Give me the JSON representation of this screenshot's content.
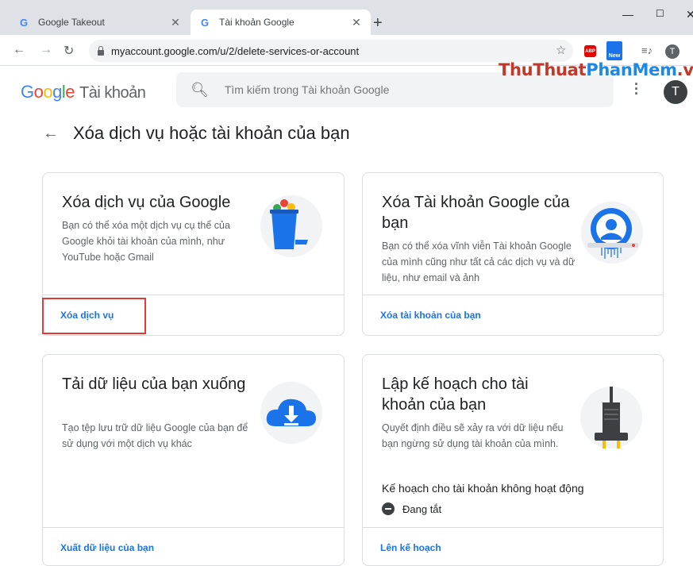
{
  "browser": {
    "tabs": [
      {
        "title": "Google Takeout",
        "icon": "G"
      },
      {
        "title": "Tài khoản Google",
        "icon": "G"
      }
    ],
    "new_tab": "+",
    "window_controls": {
      "minimize": "—",
      "maximize": "☐",
      "close": "✕"
    },
    "nav": {
      "back": "←",
      "forward": "→",
      "reload": "↻"
    },
    "url": "myaccount.google.com/u/2/delete-services-or-account",
    "star": "☆",
    "abp_label": "ABP",
    "new_ext_label": "New",
    "media_icon": "≡♪",
    "profile_initial": "T"
  },
  "watermark": {
    "part1": "ThuThuat",
    "part2": "PhanMem",
    "part3": ".vn"
  },
  "header": {
    "logo_letters": [
      "G",
      "o",
      "o",
      "g",
      "l",
      "e"
    ],
    "logo_colors": [
      "#4285f4",
      "#ea4335",
      "#fbbc05",
      "#4285f4",
      "#34a853",
      "#ea4335"
    ],
    "product": "Tài khoản",
    "search_placeholder": "Tìm kiếm trong Tài khoản Google",
    "avatar_initial": "T"
  },
  "page": {
    "back": "←",
    "title": "Xóa dịch vụ hoặc tài khoản của bạn"
  },
  "cards": [
    {
      "title": "Xóa dịch vụ của Google",
      "description": "Bạn có thể xóa một dịch vụ cụ thể của Google khỏi tài khoản của mình, như YouTube hoặc Gmail",
      "link": "Xóa dịch vụ"
    },
    {
      "title": "Xóa Tài khoản Google của bạn",
      "description": "Bạn có thể xóa vĩnh viễn Tài khoản Google của mình cũng như tất cả các dịch vụ và dữ liệu, như email và ảnh",
      "link": "Xóa tài khoản của bạn"
    },
    {
      "title": "Tải dữ liệu của bạn xuống",
      "description": "Tạo tệp lưu trữ dữ liệu Google của bạn để sử dụng với một dịch vụ khác",
      "link": "Xuất dữ liệu của bạn"
    },
    {
      "title": "Lập kế hoạch cho tài khoản của bạn",
      "description": "Quyết định điều sẽ xảy ra với dữ liệu nếu bạn ngừng sử dụng tài khoản của mình.",
      "inactive_label": "Kế hoạch cho tài khoản không hoạt động",
      "status": "Đang tắt",
      "link": "Lên kế hoạch"
    }
  ]
}
